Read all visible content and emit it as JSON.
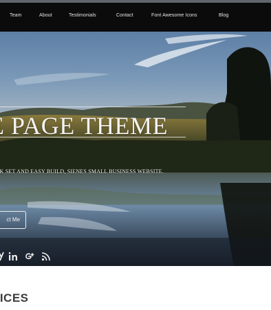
{
  "nav": {
    "items": [
      {
        "label": "Team"
      },
      {
        "label": "About"
      },
      {
        "label": "Testimonials"
      },
      {
        "label": "Contact"
      },
      {
        "label": "Font Awesome Icons"
      },
      {
        "label": "Blog"
      }
    ]
  },
  "hero": {
    "title": "E PAGE THEME",
    "tagline": "CK SET AND EASY BUILD, SIENES SMALL BUSINESS WEBSITE.",
    "button_label": "ct Me",
    "social": [
      {
        "icon": "twitter-icon",
        "glyph": "y"
      },
      {
        "icon": "linkedin-icon",
        "glyph": "in"
      },
      {
        "icon": "google-plus-icon",
        "glyph": "g+"
      },
      {
        "icon": "rss-icon",
        "glyph": "rss"
      }
    ]
  },
  "services": {
    "heading": "VICES"
  },
  "colors": {
    "navbar": "#0b0b0c",
    "sky": "#5f86ad",
    "heading_text": "#3c3c3c"
  }
}
